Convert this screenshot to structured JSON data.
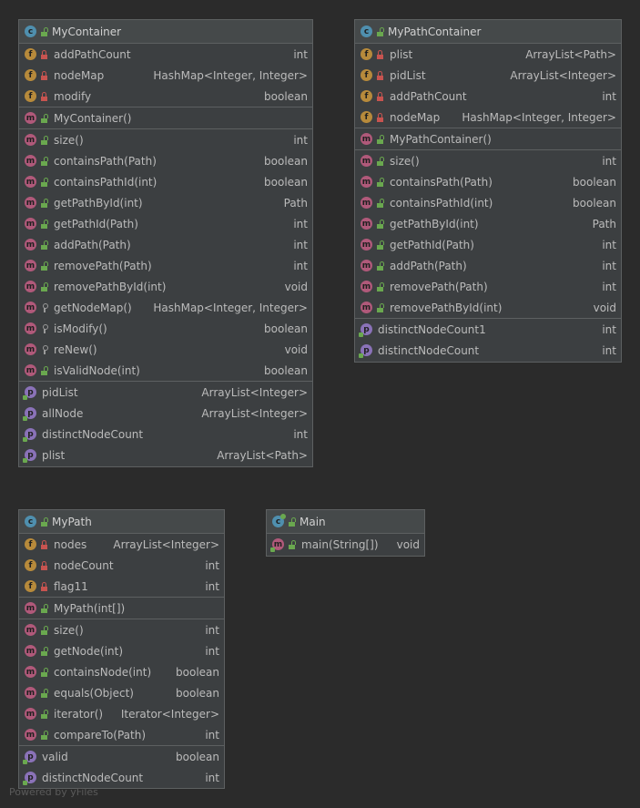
{
  "footer": "Powered by yFiles",
  "classes": {
    "mycontainer": {
      "title": "MyContainer",
      "fields": [
        {
          "name": "addPathCount",
          "type": "int"
        },
        {
          "name": "nodeMap",
          "type": "HashMap<Integer, Integer>"
        },
        {
          "name": "modify",
          "type": "boolean"
        }
      ],
      "constructors": [
        {
          "name": "MyContainer()",
          "type": ""
        }
      ],
      "methods": [
        {
          "name": "size()",
          "type": "int"
        },
        {
          "name": "containsPath(Path)",
          "type": "boolean"
        },
        {
          "name": "containsPathId(int)",
          "type": "boolean"
        },
        {
          "name": "getPathById(int)",
          "type": "Path"
        },
        {
          "name": "getPathId(Path)",
          "type": "int"
        },
        {
          "name": "addPath(Path)",
          "type": "int"
        },
        {
          "name": "removePath(Path)",
          "type": "int"
        },
        {
          "name": "removePathById(int)",
          "type": "void"
        },
        {
          "name": "getNodeMap()",
          "type": "HashMap<Integer, Integer>"
        },
        {
          "name": "isModify()",
          "type": "boolean"
        },
        {
          "name": "reNew()",
          "type": "void"
        },
        {
          "name": "isValidNode(int)",
          "type": "boolean"
        }
      ],
      "properties": [
        {
          "name": "pidList",
          "type": "ArrayList<Integer>"
        },
        {
          "name": "allNode",
          "type": "ArrayList<Integer>"
        },
        {
          "name": "distinctNodeCount",
          "type": "int"
        },
        {
          "name": "plist",
          "type": "ArrayList<Path>"
        }
      ]
    },
    "mypathcontainer": {
      "title": "MyPathContainer",
      "fields": [
        {
          "name": "plist",
          "type": "ArrayList<Path>"
        },
        {
          "name": "pidList",
          "type": "ArrayList<Integer>"
        },
        {
          "name": "addPathCount",
          "type": "int"
        },
        {
          "name": "nodeMap",
          "type": "HashMap<Integer, Integer>"
        }
      ],
      "constructors": [
        {
          "name": "MyPathContainer()",
          "type": ""
        }
      ],
      "methods": [
        {
          "name": "size()",
          "type": "int"
        },
        {
          "name": "containsPath(Path)",
          "type": "boolean"
        },
        {
          "name": "containsPathId(int)",
          "type": "boolean"
        },
        {
          "name": "getPathById(int)",
          "type": "Path"
        },
        {
          "name": "getPathId(Path)",
          "type": "int"
        },
        {
          "name": "addPath(Path)",
          "type": "int"
        },
        {
          "name": "removePath(Path)",
          "type": "int"
        },
        {
          "name": "removePathById(int)",
          "type": "void"
        }
      ],
      "properties": [
        {
          "name": "distinctNodeCount1",
          "type": "int"
        },
        {
          "name": "distinctNodeCount",
          "type": "int"
        }
      ]
    },
    "mypath": {
      "title": "MyPath",
      "fields": [
        {
          "name": "nodes",
          "type": "ArrayList<Integer>"
        },
        {
          "name": "nodeCount",
          "type": "int"
        },
        {
          "name": "flag11",
          "type": "int"
        }
      ],
      "constructors": [
        {
          "name": "MyPath(int[])",
          "type": ""
        }
      ],
      "methods": [
        {
          "name": "size()",
          "type": "int"
        },
        {
          "name": "getNode(int)",
          "type": "int"
        },
        {
          "name": "containsNode(int)",
          "type": "boolean"
        },
        {
          "name": "equals(Object)",
          "type": "boolean"
        },
        {
          "name": "iterator()",
          "type": "Iterator<Integer>"
        },
        {
          "name": "compareTo(Path)",
          "type": "int"
        }
      ],
      "properties": [
        {
          "name": "valid",
          "type": "boolean"
        },
        {
          "name": "distinctNodeCount",
          "type": "int"
        }
      ]
    },
    "main": {
      "title": "Main",
      "methods": [
        {
          "name": "main(String[])",
          "type": "void"
        }
      ]
    }
  }
}
